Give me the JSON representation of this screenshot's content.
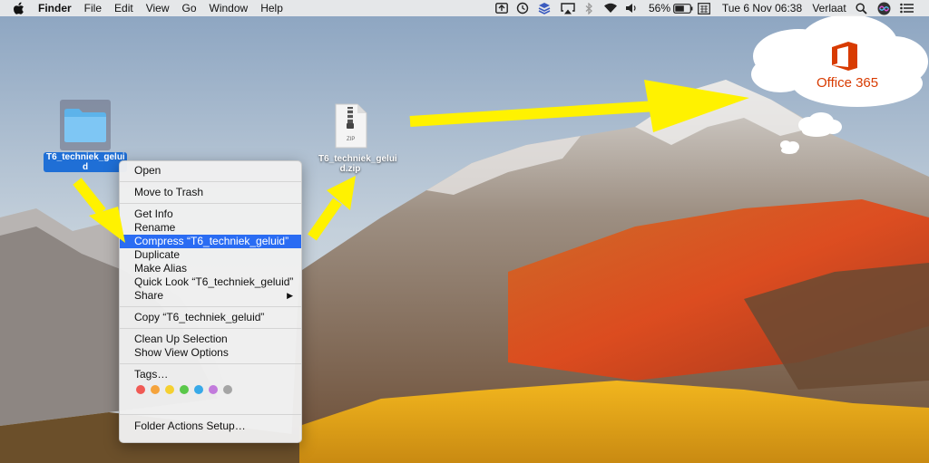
{
  "menubar": {
    "app": "Finder",
    "items": [
      "File",
      "Edit",
      "View",
      "Go",
      "Window",
      "Help"
    ],
    "battery": "56%",
    "datetime": "Tue 6 Nov  06:38",
    "user": "Verlaat"
  },
  "desktop": {
    "folder_label": "T6_techniek_gelui d",
    "zip_label": "T6_techniek_gelui d.zip",
    "zip_badge": "ZIP"
  },
  "context_menu": {
    "open": "Open",
    "move_to_trash": "Move to Trash",
    "get_info": "Get Info",
    "rename": "Rename",
    "compress": "Compress “T6_techniek_geluid”",
    "duplicate": "Duplicate",
    "make_alias": "Make Alias",
    "quick_look": "Quick Look “T6_techniek_geluid”",
    "share": "Share",
    "copy": "Copy “T6_techniek_geluid”",
    "clean_up": "Clean Up Selection",
    "show_view_options": "Show View Options",
    "tags": "Tags…",
    "folder_actions": "Folder Actions Setup…",
    "tag_colors": [
      "#f05a55",
      "#f5a33c",
      "#f5d031",
      "#5ac84a",
      "#38a9e8",
      "#c27bdc",
      "#a5a5a5"
    ]
  },
  "annotation": {
    "brand": "Office 365",
    "arrow_color": "#fff200",
    "brand_color": "#d83b01"
  }
}
